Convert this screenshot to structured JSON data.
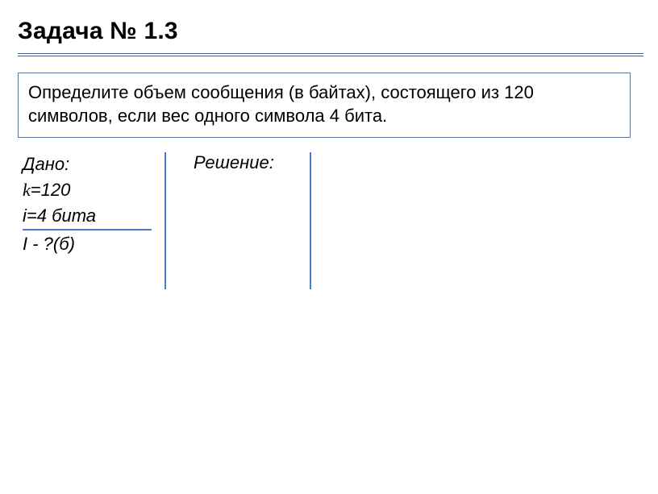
{
  "title": "Задача № 1.3",
  "problem": "Определите объем сообщения (в байтах), состоящего из 120 символов, если вес одного символа 4 бита.",
  "given": {
    "label": "Дано:",
    "line1_prefix": "k",
    "line1_suffix": "=120",
    "line2": "i=4 бита",
    "line3": "I - ?(б)"
  },
  "solution": {
    "label": "Решение:"
  }
}
